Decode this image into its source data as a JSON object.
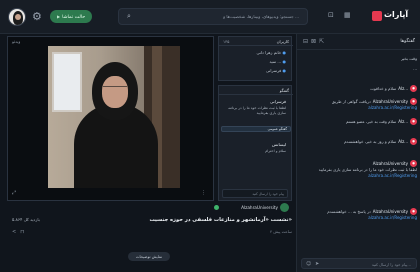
{
  "topbar": {
    "mode_label": "حالت تماشا",
    "search_placeholder": "جستجو: ویدیوهای، وبینارها، شخصیت‌ها و ...",
    "logo_text": "آپارات"
  },
  "video": {
    "label": "ویدئو"
  },
  "users": {
    "title": "کاربران",
    "count": "۱۳۵",
    "list": [
      "خانم زهرا دانی",
      "سید ...",
      "فرسرانی"
    ]
  },
  "session_chat": {
    "title": "گفتگو",
    "messages": [
      {
        "name": "فرسرانی",
        "text": "لطفا با ثبت نظرات خود ما را در برنامه سازی یاری بفرمایید"
      },
      {
        "name": "لیسانس",
        "text": "سلام و احترام"
      }
    ],
    "highlight": "گفتگو عمومی",
    "input_placeholder": "پیام خود را ارسال کنید"
  },
  "presenter": {
    "name": "AlzahraUniversity"
  },
  "chat": {
    "title": "گفتگوها",
    "messages": [
      {
        "name": "",
        "text": "وقت بخیر",
        "link": "",
        "badge": "dark"
      },
      {
        "name": "",
        "text": "...",
        "link": "",
        "badge": "dark"
      },
      {
        "name": "Alz...",
        "text": "سلام و خداقوت",
        "link": "",
        "badge": "red"
      },
      {
        "name": "AlzahraUniversity",
        "text": "دریافت گواهی از طریق",
        "link": "alzahra.ac.ir/Registering",
        "badge": "red"
      },
      {
        "name": "Alz...",
        "text": "سلام وقت به خیر، عضو هستم",
        "link": "",
        "badge": "red"
      },
      {
        "name": "Alz...",
        "text": "سلام و روز به خیر، خواهشمندم",
        "link": "",
        "badge": "red"
      },
      {
        "name": "AlzahraUniversity",
        "text": "لطفا با ثبت نظرات خود ما را در برنامه سازی یاری بفرمایید",
        "link": "alzahra.ac.ir/Registering",
        "badge": "red"
      },
      {
        "name": "AlzahraUniversity",
        "text": "در پاسخ به ... خواهشمندم",
        "link": "alzahra.ac.ir/Registering",
        "badge": "red"
      }
    ],
    "input_placeholder": "پیام خود را ارسال کنید..."
  },
  "info": {
    "title": "نشست «آرمانشهر و منازعات فلسفی در حوزه جنسیت»",
    "subtitle": "۴ ساعت پیش",
    "views": "۵،۸۶۴ بازدید کل",
    "description_button": "نمایش توضیحات"
  }
}
